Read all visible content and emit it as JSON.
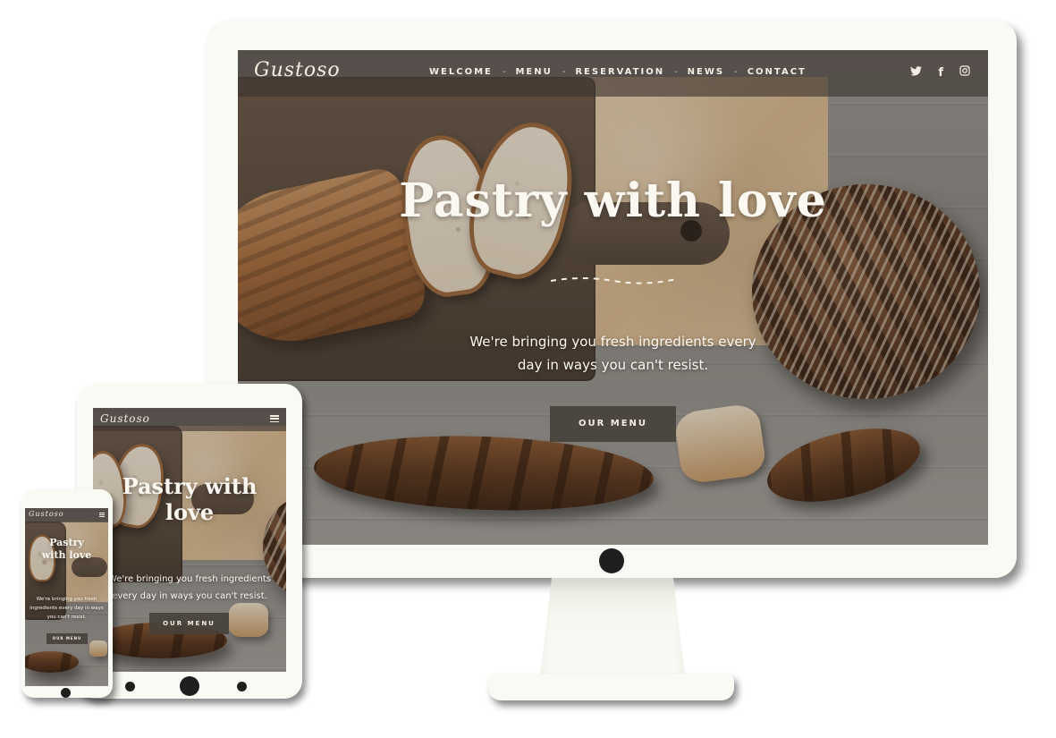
{
  "site": {
    "logo": "Gustoso",
    "nav": [
      "WELCOME",
      "MENU",
      "RESERVATION",
      "NEWS",
      "CONTACT"
    ],
    "nav_separator": "-",
    "social": [
      {
        "name": "twitter-icon",
        "glyph": "🐦"
      },
      {
        "name": "facebook-icon",
        "glyph": "f"
      },
      {
        "name": "instagram-icon",
        "glyph": "◎"
      }
    ],
    "hero": {
      "title": "Pastry with love",
      "subtitle": "We're bringing you fresh ingredients every day in ways you can't resist.",
      "button": "OUR MENU"
    }
  },
  "colors": {
    "device_frame": "#fafaf4",
    "navbar_bg": "#3c342e",
    "button_bg": "#46403a",
    "text_light": "#fbf7f1"
  }
}
